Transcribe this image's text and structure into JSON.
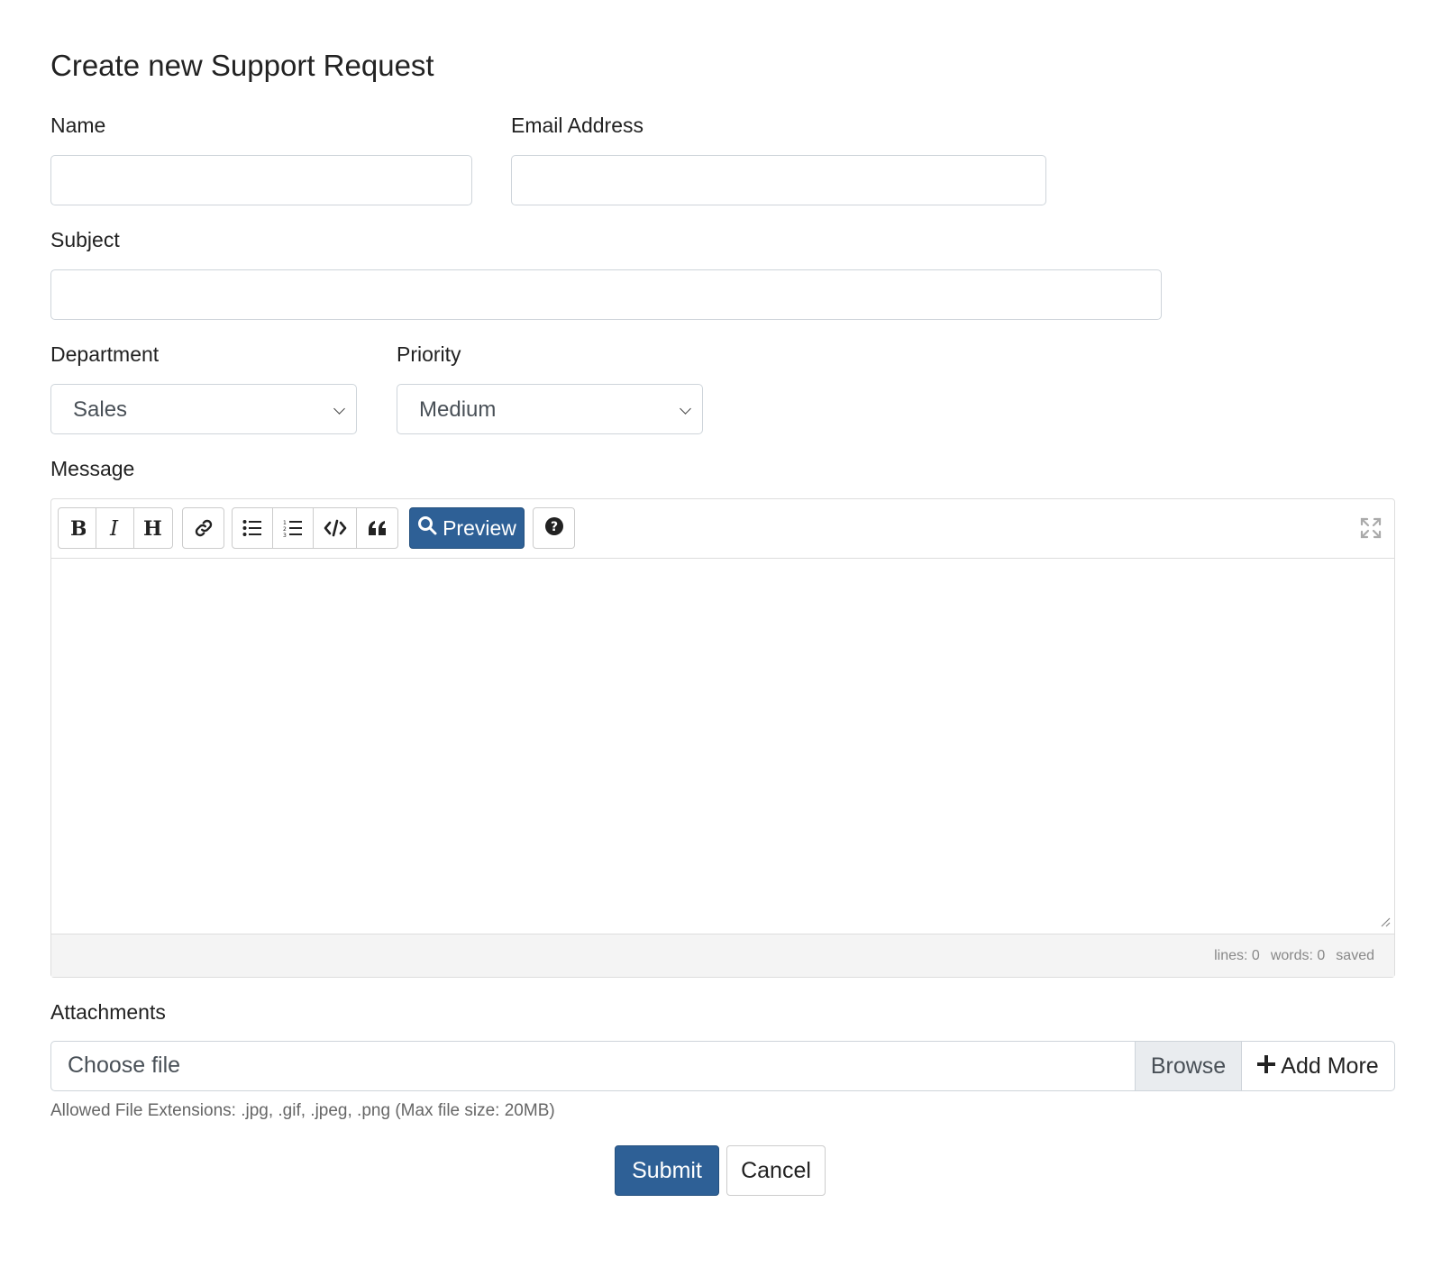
{
  "page": {
    "title": "Create new Support Request"
  },
  "form": {
    "name_label": "Name",
    "name_value": "",
    "email_label": "Email Address",
    "email_value": "",
    "subject_label": "Subject",
    "subject_value": "",
    "department_label": "Department",
    "department_selected": "Sales",
    "priority_label": "Priority",
    "priority_selected": "Medium",
    "message_label": "Message"
  },
  "editor": {
    "toolbar": {
      "bold_icon": "bold-icon",
      "italic_icon": "italic-icon",
      "heading_icon": "heading-icon",
      "link_icon": "link-icon",
      "unordered_list_icon": "unordered-list-icon",
      "ordered_list_icon": "ordered-list-icon",
      "code_icon": "code-icon",
      "quote_icon": "quote-icon",
      "preview_label": "Preview",
      "help_icon": "question-circle-icon",
      "fullscreen_icon": "expand-icon"
    },
    "content": "",
    "status": {
      "lines": "lines: 0",
      "words": "words: 0",
      "saved": "saved"
    }
  },
  "attachments": {
    "label": "Attachments",
    "file_placeholder": "Choose file",
    "browse_label": "Browse",
    "add_more_label": "Add More",
    "hint": "Allowed File Extensions: .jpg, .gif, .jpeg, .png (Max file size: 20MB)"
  },
  "actions": {
    "submit_label": "Submit",
    "cancel_label": "Cancel"
  },
  "colors": {
    "primary": "#2e6096",
    "border": "#ced4da",
    "statusbar_bg": "#f4f4f4"
  }
}
